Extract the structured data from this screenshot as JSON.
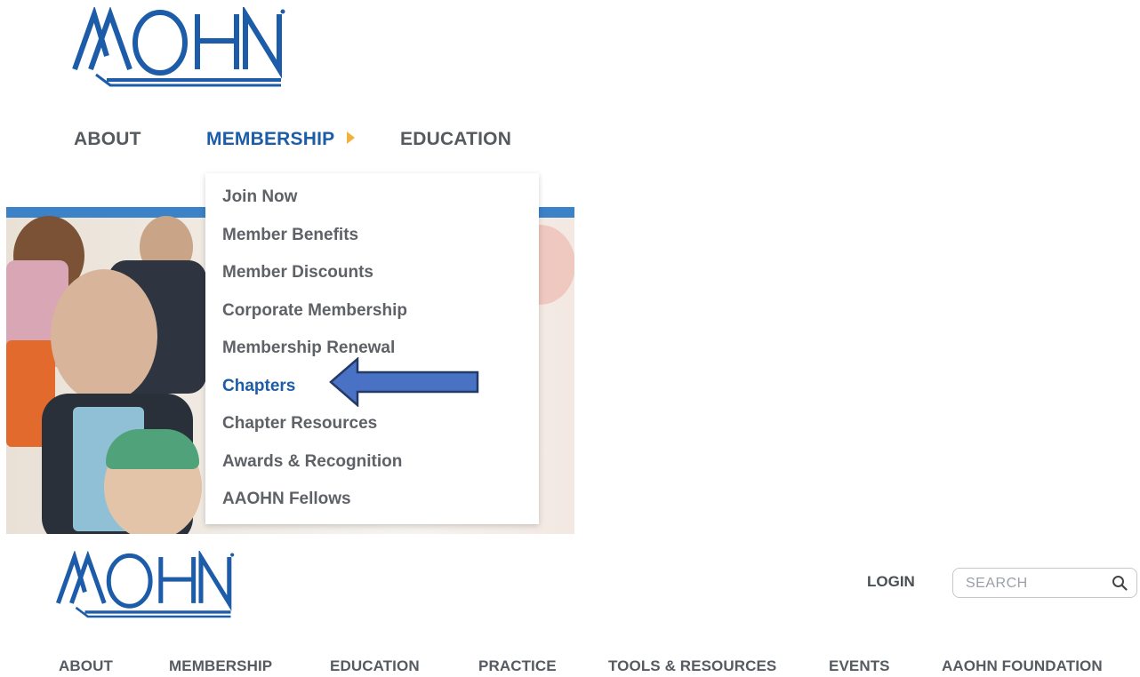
{
  "logo": {
    "text": "AAOHN",
    "color": "#1d5ca8"
  },
  "top_nav": {
    "items": [
      {
        "label": "ABOUT",
        "active": false
      },
      {
        "label": "MEMBERSHIP",
        "active": true
      },
      {
        "label": "EDUCATION",
        "active": false
      }
    ],
    "caret_color": "#f0b23b"
  },
  "dropdown": {
    "items": [
      {
        "label": "Join Now"
      },
      {
        "label": "Member Benefits"
      },
      {
        "label": "Member Discounts"
      },
      {
        "label": "Corporate Membership"
      },
      {
        "label": "Membership Renewal"
      },
      {
        "label": "Chapters",
        "selected": true
      },
      {
        "label": "Chapter Resources"
      },
      {
        "label": "Awards & Recognition"
      },
      {
        "label": "AAOHN Fellows"
      }
    ]
  },
  "annotation": {
    "icon": "left-arrow-icon",
    "fill": "#4a72c4",
    "stroke": "#233a66"
  },
  "header": {
    "login_label": "LOGIN",
    "search": {
      "placeholder": "SEARCH",
      "value": "",
      "icon": "search-icon"
    }
  },
  "bottom_nav": {
    "items": [
      {
        "label": "ABOUT"
      },
      {
        "label": "MEMBERSHIP"
      },
      {
        "label": "EDUCATION"
      },
      {
        "label": "PRACTICE"
      },
      {
        "label": "TOOLS & RESOURCES"
      },
      {
        "label": "EVENTS"
      },
      {
        "label": "AAOHN FOUNDATION"
      }
    ]
  },
  "colors": {
    "brand_blue": "#1d5ca8",
    "hero_bar": "#3b82c7",
    "text_gray": "#5e6166"
  }
}
